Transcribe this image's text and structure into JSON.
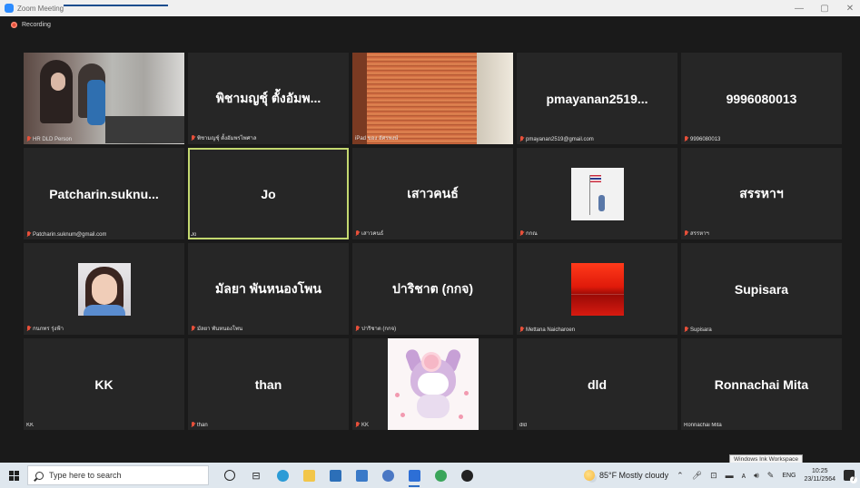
{
  "window": {
    "title": "Zoom Meeting"
  },
  "meeting": {
    "recording_label": "Recording",
    "tiles": [
      {
        "kind": "video",
        "video": "photo-hr",
        "label": "HR DLD Person",
        "muted": true
      },
      {
        "kind": "name",
        "display": "พิชามญชุ์ ตั้งอัมพ...",
        "label": "พิชามญชุ์ ตั้งอัมพรไพศาล",
        "muted": true
      },
      {
        "kind": "video",
        "video": "photo-blinds",
        "label": "iPad ของ อัศรพงษ์",
        "muted": false
      },
      {
        "kind": "name",
        "display": "pmayanan2519...",
        "label": "pmayanan2519@gmail.com",
        "muted": true
      },
      {
        "kind": "name",
        "display": "9996080013",
        "label": "9996080013",
        "muted": true
      },
      {
        "kind": "name",
        "display": "Patcharin.suknu...",
        "label": "Patcharin.suknum@gmail.com",
        "muted": true
      },
      {
        "kind": "name",
        "display": "Jo",
        "label": "Jo",
        "muted": false,
        "active": true
      },
      {
        "kind": "name",
        "display": "เสาวคนธ์",
        "label": "เสาวคนธ์",
        "muted": true
      },
      {
        "kind": "avatar",
        "avatar": "photo-flag",
        "label": "กกณ",
        "muted": true
      },
      {
        "kind": "name",
        "display": "สรรหาฯ",
        "label": "สรรหาฯ",
        "muted": true
      },
      {
        "kind": "avatar",
        "avatar": "photo-girl",
        "label": "กนกทร รุ่งฟ้า",
        "muted": true
      },
      {
        "kind": "name",
        "display": "มัลยา พันหนองโพน",
        "label": "มัลยา พันหนองโพน",
        "muted": true
      },
      {
        "kind": "name",
        "display": "ปาริชาต (กกจ)",
        "label": "ปาริชาต (กกจ)",
        "muted": true
      },
      {
        "kind": "avatar",
        "avatar": "photo-red",
        "label": "Mettana Naicharoen",
        "muted": true
      },
      {
        "kind": "name",
        "display": "Supisara",
        "label": "Supisara",
        "muted": true
      },
      {
        "kind": "name",
        "display": "KK",
        "label": "KK",
        "muted": false
      },
      {
        "kind": "name",
        "display": "than",
        "label": "than",
        "muted": true
      },
      {
        "kind": "avatar",
        "avatar": "photo-kuromi",
        "label": "KK",
        "muted": true
      },
      {
        "kind": "name",
        "display": "dld",
        "label": "dld",
        "muted": false
      },
      {
        "kind": "name",
        "display": "Ronnachai Mita",
        "label": "Ronnachai Mita",
        "muted": false
      }
    ]
  },
  "tooltip": "Windows Ink Workspace",
  "taskbar": {
    "search_placeholder": "Type here to search",
    "weather": "85°F  Mostly cloudy",
    "language": "ENG",
    "time": "10:25",
    "date": "23/11/2564",
    "notification_count": "7",
    "app_icons": [
      {
        "name": "cortana-icon",
        "glyph": ""
      },
      {
        "name": "task-view-icon",
        "glyph": "⊟"
      },
      {
        "name": "edge-icon",
        "color": "#2b9bd6"
      },
      {
        "name": "file-explorer-icon",
        "color": "#f2c64a"
      },
      {
        "name": "store-icon",
        "color": "#2c6fb8"
      },
      {
        "name": "teams-icon",
        "color": "#3a7ac8"
      },
      {
        "name": "app-icon",
        "color": "#4a78c4"
      },
      {
        "name": "zoom-icon",
        "color": "#2d6fd6"
      },
      {
        "name": "chrome-icon",
        "color": "#3aa55a"
      },
      {
        "name": "obs-icon",
        "color": "#222222"
      }
    ]
  }
}
